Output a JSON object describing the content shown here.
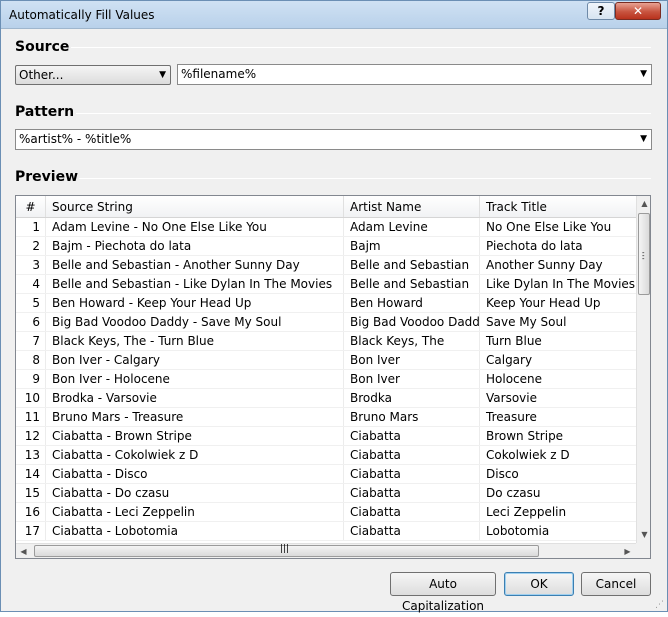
{
  "window": {
    "title": "Automatically Fill Values",
    "help_label": "?",
    "close_label": "✕"
  },
  "source": {
    "label": "Source",
    "type_selected": "Other...",
    "value": "%filename%"
  },
  "pattern": {
    "label": "Pattern",
    "value": "%artist% - %title%"
  },
  "preview": {
    "label": "Preview",
    "columns": [
      "#",
      "Source String",
      "Artist Name",
      "Track Title"
    ],
    "rows": [
      {
        "n": "1",
        "src": "Adam Levine - No One Else Like You",
        "artist": "Adam Levine",
        "title": "No One Else Like You"
      },
      {
        "n": "2",
        "src": "Bajm - Piechota do lata",
        "artist": "Bajm",
        "title": "Piechota do lata"
      },
      {
        "n": "3",
        "src": "Belle and Sebastian - Another Sunny Day",
        "artist": "Belle and Sebastian",
        "title": "Another Sunny Day"
      },
      {
        "n": "4",
        "src": "Belle and Sebastian - Like Dylan In The Movies",
        "artist": "Belle and Sebastian",
        "title": "Like Dylan In The Movies"
      },
      {
        "n": "5",
        "src": "Ben Howard - Keep Your Head Up",
        "artist": "Ben Howard",
        "title": "Keep Your Head Up"
      },
      {
        "n": "6",
        "src": "Big Bad Voodoo Daddy - Save My Soul",
        "artist": "Big Bad Voodoo Daddy",
        "title": "Save My Soul"
      },
      {
        "n": "7",
        "src": "Black Keys, The - Turn Blue",
        "artist": "Black Keys, The",
        "title": "Turn Blue"
      },
      {
        "n": "8",
        "src": "Bon Iver - Calgary",
        "artist": "Bon Iver",
        "title": "Calgary"
      },
      {
        "n": "9",
        "src": "Bon Iver - Holocene",
        "artist": "Bon Iver",
        "title": "Holocene"
      },
      {
        "n": "10",
        "src": "Brodka - Varsovie",
        "artist": "Brodka",
        "title": "Varsovie"
      },
      {
        "n": "11",
        "src": "Bruno Mars - Treasure",
        "artist": "Bruno Mars",
        "title": "Treasure"
      },
      {
        "n": "12",
        "src": "Ciabatta - Brown Stripe",
        "artist": "Ciabatta",
        "title": "Brown Stripe"
      },
      {
        "n": "13",
        "src": "Ciabatta - Cokolwiek z D",
        "artist": "Ciabatta",
        "title": "Cokolwiek z D"
      },
      {
        "n": "14",
        "src": "Ciabatta - Disco",
        "artist": "Ciabatta",
        "title": "Disco"
      },
      {
        "n": "15",
        "src": "Ciabatta - Do czasu",
        "artist": "Ciabatta",
        "title": "Do czasu"
      },
      {
        "n": "16",
        "src": "Ciabatta - Leci Zeppelin",
        "artist": "Ciabatta",
        "title": "Leci Zeppelin"
      },
      {
        "n": "17",
        "src": "Ciabatta - Lobotomia",
        "artist": "Ciabatta",
        "title": "Lobotomia"
      }
    ]
  },
  "buttons": {
    "auto_cap": "Auto Capitalization",
    "ok": "OK",
    "cancel": "Cancel"
  },
  "icons": {
    "dropdown": "chevron-down-icon",
    "scroll_up": "scroll-up-arrow-icon",
    "scroll_down": "scroll-down-arrow-icon",
    "scroll_left": "scroll-left-arrow-icon",
    "scroll_right": "scroll-right-arrow-icon"
  },
  "colors": {
    "titlebar": "#b9d1ea",
    "close_button": "#c8543f",
    "dialog_bg": "#f0f0f0"
  }
}
